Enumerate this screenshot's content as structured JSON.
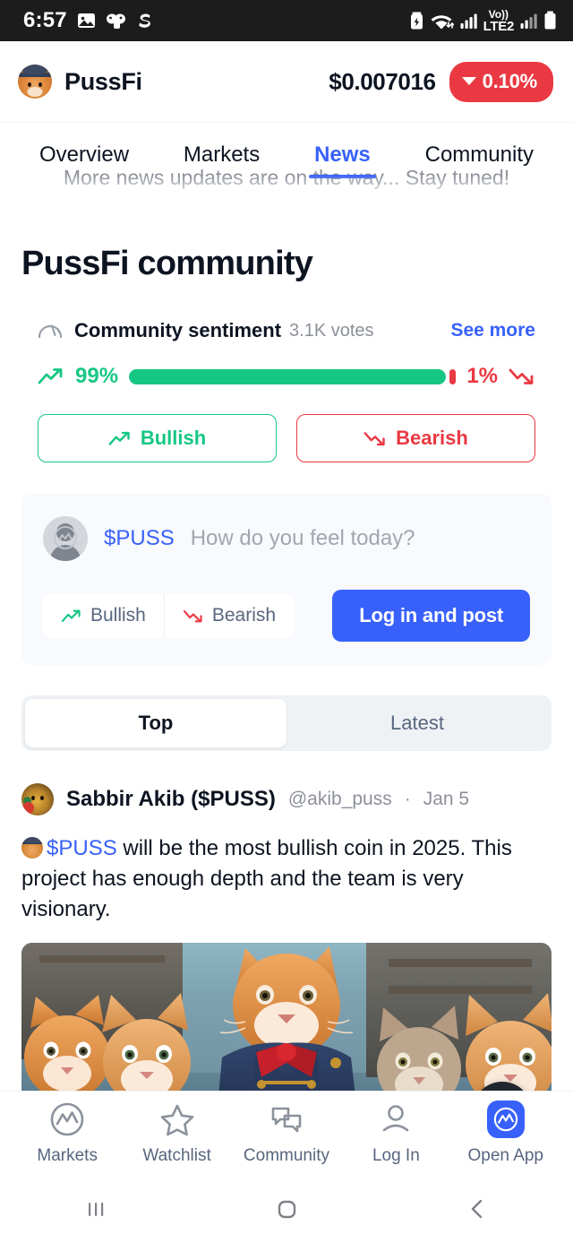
{
  "status_bar": {
    "time": "6:57",
    "left_icons": [
      "image-icon",
      "game-controller-icon",
      "s-app-icon"
    ],
    "right_icons": [
      "battery-saver-icon",
      "wifi-icon",
      "signal-bars-icon",
      "volte-lte2-icon",
      "signal-bars-2-icon",
      "battery-icon"
    ],
    "network_label": "Vo))",
    "network_sub": "LTE2"
  },
  "coin_header": {
    "logo_icon": "pussfi-cat-logo",
    "name": "PussFi",
    "price": "$0.007016",
    "change": "0.10%",
    "change_direction": "down",
    "change_color": "#ea3943"
  },
  "tabs": {
    "items": [
      {
        "label": "Overview",
        "active": false
      },
      {
        "label": "Markets",
        "active": false
      },
      {
        "label": "News",
        "active": true
      },
      {
        "label": "Community",
        "active": false
      }
    ],
    "active_color": "#3861fb",
    "ghost_text": "More news updates are on the way... Stay tuned!"
  },
  "page": {
    "title": "PussFi community"
  },
  "sentiment": {
    "icon": "gauge-icon",
    "title": "Community sentiment",
    "votes": "3.1K votes",
    "see_more": "See more",
    "bullish_pct_label": "99%",
    "bearish_pct_label": "1%",
    "bullish_pct": 99,
    "bearish_pct": 1,
    "bullish_color": "#16c784",
    "bearish_color": "#ea3943",
    "vote_buttons": [
      {
        "label": "Bullish",
        "icon": "trend-up-icon",
        "color": "#16c784"
      },
      {
        "label": "Bearish",
        "icon": "trend-down-icon",
        "color": "#ea3943"
      }
    ]
  },
  "composer": {
    "avatar_icon": "default-avatar-cmc-icon",
    "ticker": "$PUSS",
    "placeholder": "How do you feel today?",
    "sentiment_options": [
      {
        "label": "Bullish",
        "icon": "trend-up-icon"
      },
      {
        "label": "Bearish",
        "icon": "trend-down-icon"
      }
    ],
    "post_button": "Log in and post",
    "post_button_color": "#3861fb"
  },
  "feed_filter": {
    "options": [
      {
        "label": "Top",
        "active": true
      },
      {
        "label": "Latest",
        "active": false
      }
    ]
  },
  "post": {
    "avatar_icon": "user-avatar-cat",
    "author": "Sabbir Akib ($PUSS)",
    "handle": "@akib_puss",
    "separator": "·",
    "date": "Jan 5",
    "body_emoji_icon": "cat-hat-emoji",
    "body_cashtag": "$PUSS",
    "body_text": " will be the most bullish coin in 2025. This project has enough depth and the team is very visionary.",
    "image_alt": "naval-cats-illustration"
  },
  "scroll_top_button": {
    "icon": "chevron-up-icon"
  },
  "bottom_nav": {
    "items": [
      {
        "label": "Markets",
        "icon": "cmc-logo-icon",
        "active": false
      },
      {
        "label": "Watchlist",
        "icon": "star-icon",
        "active": false
      },
      {
        "label": "Community",
        "icon": "chat-bubbles-icon",
        "active": false
      },
      {
        "label": "Log In",
        "icon": "person-icon",
        "active": false
      },
      {
        "label": "Open App",
        "icon": "cmc-app-icon",
        "active": true
      }
    ]
  },
  "android_nav": {
    "recents": "recents-icon",
    "home": "home-icon",
    "back": "back-icon"
  }
}
